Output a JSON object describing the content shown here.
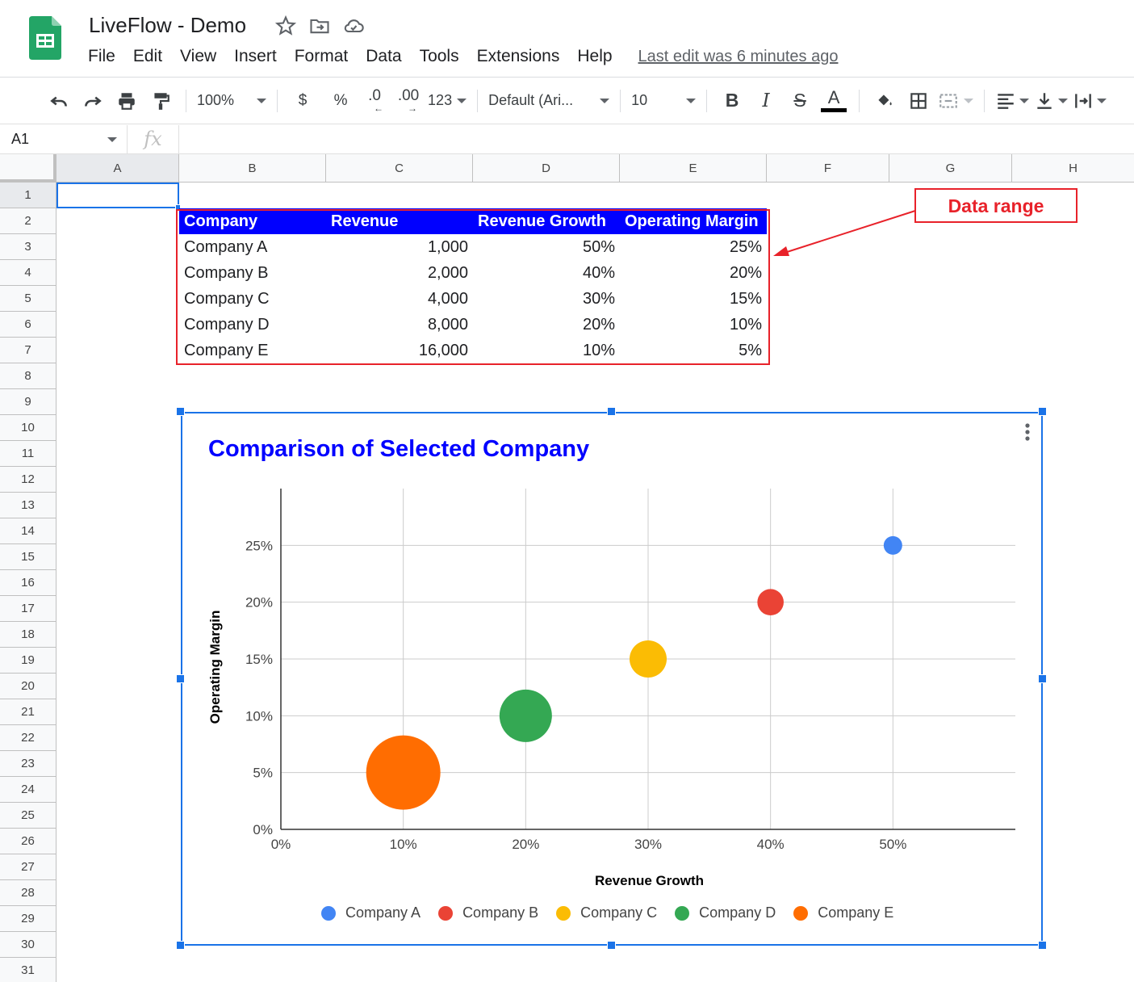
{
  "app": {
    "title": "LiveFlow - Demo",
    "last_edit": "Last edit was 6 minutes ago"
  },
  "menu": [
    "File",
    "Edit",
    "View",
    "Insert",
    "Format",
    "Data",
    "Tools",
    "Extensions",
    "Help"
  ],
  "toolbar": {
    "zoom": "100%",
    "currency": "$",
    "percent": "%",
    "decrease_decimal": ".0",
    "increase_decimal": ".00",
    "more_formats": "123",
    "font": "Default (Ari...",
    "font_size": "10",
    "bold": "B",
    "italic": "I",
    "strike": "S",
    "text_color": "A"
  },
  "formula_bar": {
    "cell_ref": "A1",
    "fx": "fx",
    "value": ""
  },
  "columns": [
    "A",
    "B",
    "C",
    "D",
    "E",
    "F",
    "G",
    "H"
  ],
  "rows": [
    "1",
    "2",
    "3",
    "4",
    "5",
    "6",
    "7",
    "8",
    "9",
    "10",
    "11",
    "12",
    "13",
    "14",
    "15",
    "16",
    "17",
    "18",
    "19",
    "20",
    "21",
    "22",
    "23",
    "24",
    "25",
    "26",
    "27",
    "28",
    "29",
    "30",
    "31"
  ],
  "table": {
    "headers": [
      "Company",
      "Revenue",
      "Revenue Growth",
      "Operating Margin"
    ],
    "rows": [
      [
        "Company A",
        "1,000",
        "50%",
        "25%"
      ],
      [
        "Company B",
        "2,000",
        "40%",
        "20%"
      ],
      [
        "Company C",
        "4,000",
        "30%",
        "15%"
      ],
      [
        "Company D",
        "8,000",
        "20%",
        "10%"
      ],
      [
        "Company E",
        "16,000",
        "10%",
        "5%"
      ]
    ]
  },
  "annotation": {
    "label": "Data range",
    "color": "#e8222a"
  },
  "chart_data": {
    "type": "scatter",
    "title": "Comparison of Selected Company",
    "xlabel": "Revenue Growth",
    "ylabel": "Operating Margin",
    "xlim": [
      0,
      0.6
    ],
    "ylim": [
      0,
      0.3
    ],
    "x_ticks": [
      "0%",
      "10%",
      "20%",
      "30%",
      "40%",
      "50%"
    ],
    "y_ticks": [
      "0%",
      "5%",
      "10%",
      "15%",
      "20%",
      "25%"
    ],
    "grid": true,
    "legend_position": "bottom",
    "series": [
      {
        "name": "Company A",
        "x": 0.5,
        "y": 0.25,
        "size": 1000,
        "color": "#4285f4"
      },
      {
        "name": "Company B",
        "x": 0.4,
        "y": 0.2,
        "size": 2000,
        "color": "#ea4335"
      },
      {
        "name": "Company C",
        "x": 0.3,
        "y": 0.15,
        "size": 4000,
        "color": "#fbbc04"
      },
      {
        "name": "Company D",
        "x": 0.2,
        "y": 0.1,
        "size": 8000,
        "color": "#34a853"
      },
      {
        "name": "Company E",
        "x": 0.1,
        "y": 0.05,
        "size": 16000,
        "color": "#ff6d01"
      }
    ]
  }
}
